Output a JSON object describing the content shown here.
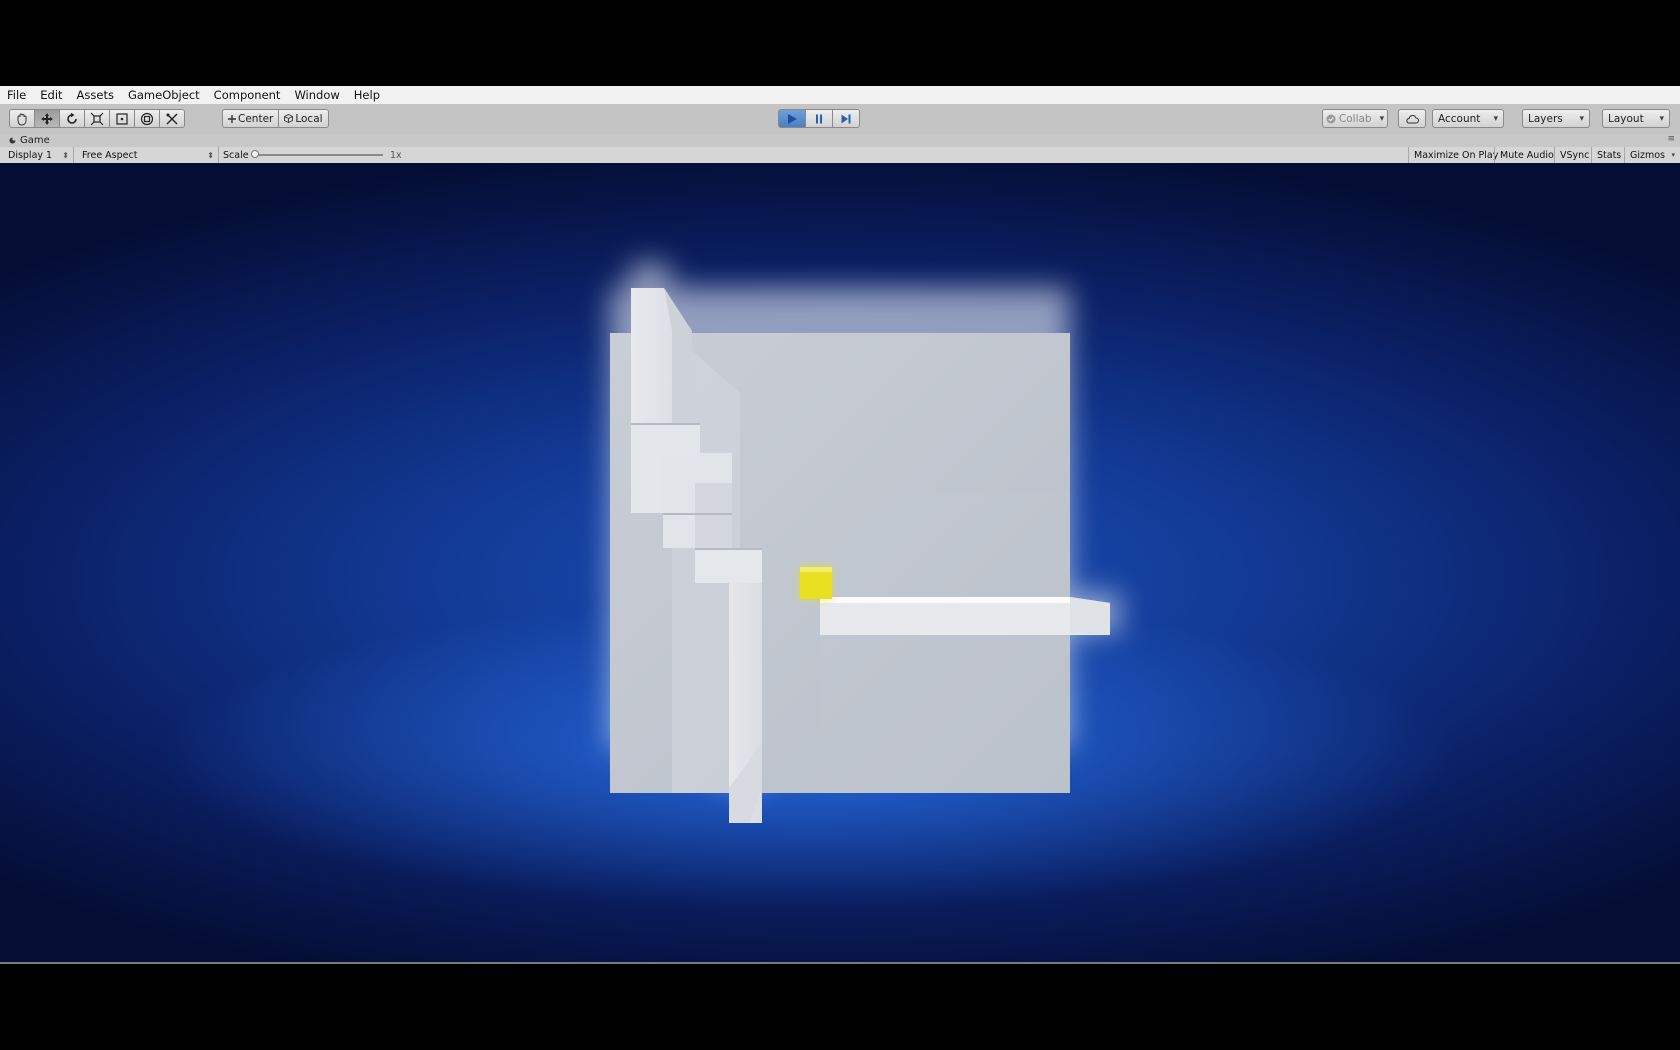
{
  "menu": [
    "File",
    "Edit",
    "Assets",
    "GameObject",
    "Component",
    "Window",
    "Help"
  ],
  "toolbar": {
    "tools": [
      {
        "icon": "hand-icon",
        "label": ""
      },
      {
        "icon": "move-icon",
        "label": ""
      },
      {
        "icon": "rotate-icon",
        "label": ""
      },
      {
        "icon": "scale-icon",
        "label": ""
      },
      {
        "icon": "rect-tool-icon",
        "label": ""
      },
      {
        "icon": "transform-icon",
        "label": ""
      },
      {
        "icon": "custom-tool-icon",
        "label": ""
      }
    ],
    "pivot_mode": "Center",
    "pivot_rotation": "Local",
    "playback": {
      "play_active": true
    },
    "collab": "Collab",
    "account": "Account",
    "layers": "Layers",
    "layout": "Layout"
  },
  "tab": {
    "title": "Game",
    "icon": "game-tab-icon"
  },
  "gamebar": {
    "display": "Display 1",
    "aspect": "Free Aspect",
    "scale_label": "Scale",
    "scale_value": "1x",
    "maximize_on_play": "Maximize On Play",
    "mute_audio": "Mute Audio",
    "vsync": "VSync",
    "stats": "Stats",
    "gizmos": "Gizmos"
  },
  "colors": {
    "player": "#e8e020",
    "play_button": "#4a7fc2",
    "scene_background": "#123a95"
  }
}
